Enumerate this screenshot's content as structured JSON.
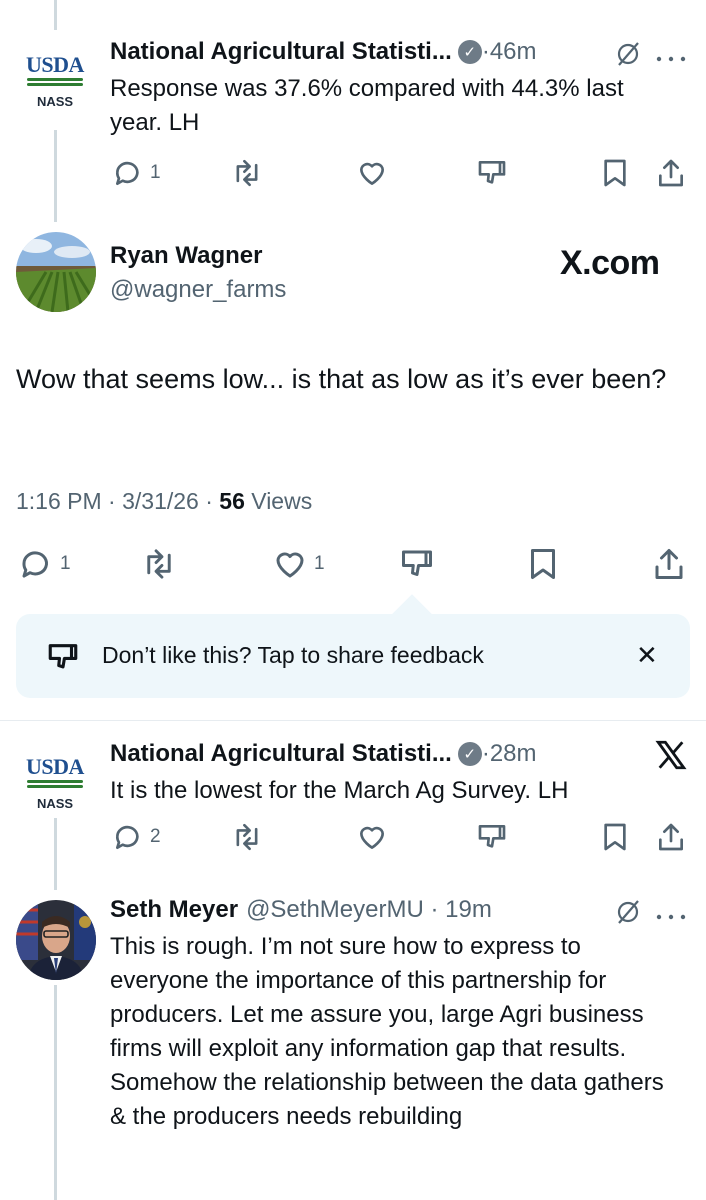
{
  "tweet1": {
    "avatar": {
      "top": "USDA",
      "bottom": "NASS"
    },
    "name": "National Agricultural Statisti...",
    "meta": "·46m",
    "text": "Response was 37.6% compared with 44.3% last year. LH",
    "reply_count": "1"
  },
  "main": {
    "name": "Ryan Wagner",
    "handle": "@wagner_farms",
    "watermark": "X.com",
    "text": "Wow that seems low... is that as low as it’s ever been?",
    "timestamp": "1:16 PM · 3/31/26 · ",
    "views_count": "56",
    "views_label": " Views",
    "reply_count": "1",
    "like_count": "1"
  },
  "feedback": {
    "text": "Don’t like this? Tap to share feedback",
    "close": "✕"
  },
  "tweet2": {
    "avatar": {
      "top": "USDA",
      "bottom": "NASS"
    },
    "name": "National Agricultural Statisti...",
    "meta": "·28m",
    "text": "It is the lowest for the March Ag Survey. LH",
    "reply_count": "2"
  },
  "tweet3": {
    "name": "Seth Meyer",
    "meta": "@SethMeyerMU · 19m",
    "text": "This is rough. I’m not sure how to express to everyone the importance of this partnership for producers. Let me assure you, large Agri business firms will exploit any information gap that results. Somehow the relationship between the data gathers & the producers needs rebuilding"
  },
  "colors": {
    "text": "#0f1419",
    "secondary": "#536471",
    "feedback_bg": "#eef7fb",
    "usda_blue": "#1f4f8f",
    "usda_green": "#2e7d32"
  },
  "icons": [
    "reply-icon",
    "retweet-icon",
    "like-icon",
    "dislike-icon",
    "bookmark-icon",
    "share-icon",
    "grok-icon",
    "more-icon",
    "x-logo-icon",
    "close-icon",
    "verified-icon"
  ]
}
